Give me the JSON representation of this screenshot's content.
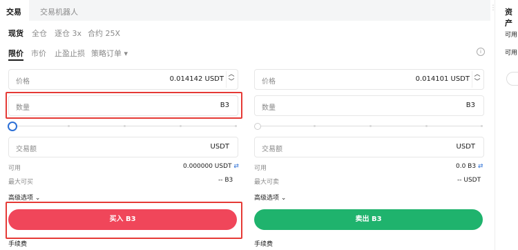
{
  "tabs": {
    "trade": "交易",
    "bot": "交易机器人"
  },
  "modes": {
    "spot": "现货",
    "cross": "全仓",
    "isolated": "逐仓 3x",
    "contract": "合约 25X"
  },
  "order_types": {
    "limit": "限价",
    "market": "市价",
    "tpsl": "止盈止损",
    "strategy": "策略订单"
  },
  "right_panel": {
    "title": "资产",
    "avail1": "可用",
    "avail2": "可用"
  },
  "buy": {
    "price_label": "价格",
    "price_value": "0.014142",
    "price_unit": "USDT",
    "qty_label": "数量",
    "qty_unit": "B3",
    "amount_label": "交易额",
    "amount_unit": "USDT",
    "avail_label": "可用",
    "avail_value": "0.000000 USDT",
    "max_label": "最大可买",
    "max_value": "-- B3",
    "advanced": "高级选项",
    "button": "买入 B3",
    "fee": "手续费"
  },
  "sell": {
    "price_label": "价格",
    "price_value": "0.014101",
    "price_unit": "USDT",
    "qty_label": "数量",
    "qty_unit": "B3",
    "amount_label": "交易额",
    "amount_unit": "USDT",
    "avail_label": "可用",
    "avail_value": "0.0 B3",
    "max_label": "最大可卖",
    "max_value": "-- USDT",
    "advanced": "高级选项",
    "button": "卖出 B3",
    "fee": "手续费"
  },
  "colors": {
    "buy": "#f0465a",
    "sell": "#1fb36d",
    "highlight": "#e53935",
    "accent": "#2b6fd6"
  }
}
